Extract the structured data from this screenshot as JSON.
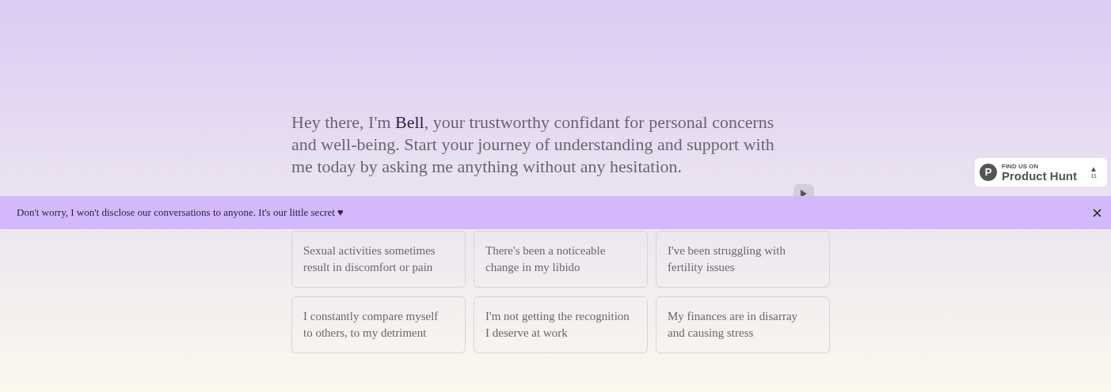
{
  "greeting": {
    "before": "Hey there, I'm ",
    "name": "Bell",
    "after": ", your trustworthy confidant for personal concerns and well-being. Start your journey of understanding and support with me today by asking me anything without any hesitation."
  },
  "suggestions": [
    "Sexual activities sometimes result in discomfort or pain",
    "There's been a noticeable change in my libido",
    "I've been struggling with fertility issues",
    "I constantly compare myself to others, to my detriment",
    "I'm not getting the recognition I deserve at work",
    "My finances are in disarray and causing stress"
  ],
  "badge": {
    "caption": "FIND US ON",
    "title": "Product Hunt",
    "letter": "P",
    "arrow": "▲",
    "count": "11"
  },
  "banner": {
    "text": "Don't worry, I won't disclose our conversations to anyone. It's our little secret ♥"
  }
}
